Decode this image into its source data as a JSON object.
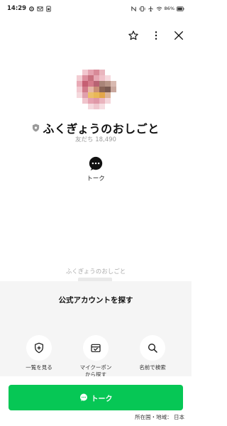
{
  "status_bar": {
    "time": "14:29",
    "battery": "86%"
  },
  "top_actions": {
    "favorite_icon": "star-icon",
    "more_icon": "more-vertical-icon",
    "close_icon": "close-icon"
  },
  "profile": {
    "name": "ふくぎょうのおしごと",
    "friends_count": "友だち 18,490",
    "badge_icon": "shield-badge-icon"
  },
  "actions": {
    "talk_label": "トーク"
  },
  "description": {
    "title": "ふくぎょうのおしごと"
  },
  "discover": {
    "title": "公式アカウントを探す",
    "items": [
      {
        "label": "一覧を見る",
        "icon": "shield-plus-icon"
      },
      {
        "label": "マイクーポン\nから探す",
        "icon": "coupon-icon"
      },
      {
        "label": "名前で検索",
        "icon": "search-icon"
      }
    ]
  },
  "bottom": {
    "talk_button_label": "トーク",
    "region_text": "所在国・地域： 日本"
  },
  "colors": {
    "accent": "#06c755",
    "panel_bg": "#f5f5f5"
  }
}
